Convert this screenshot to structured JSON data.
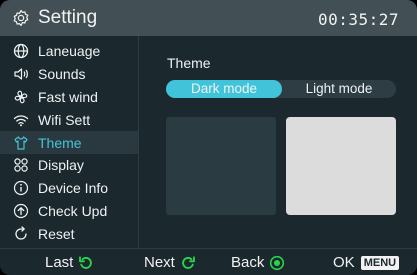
{
  "header": {
    "title": "Setting",
    "time": "00:35:27",
    "icon": "gear-icon"
  },
  "sidebar": {
    "items": [
      {
        "label": "Laneuage",
        "icon": "globe-icon",
        "active": false
      },
      {
        "label": "Sounds",
        "icon": "speaker-icon",
        "active": false
      },
      {
        "label": "Fast wind",
        "icon": "fan-icon",
        "active": false
      },
      {
        "label": "Wifi Sett",
        "icon": "wifi-icon",
        "active": false
      },
      {
        "label": "Theme",
        "icon": "shirt-icon",
        "active": true
      },
      {
        "label": "Display",
        "icon": "display-grid-icon",
        "active": false
      },
      {
        "label": "Device Info",
        "icon": "info-icon",
        "active": false
      },
      {
        "label": "Check Upd",
        "icon": "upload-icon",
        "active": false
      },
      {
        "label": "Reset",
        "icon": "reset-icon",
        "active": false
      }
    ]
  },
  "main": {
    "section_label": "Theme",
    "options": {
      "dark": "Dark mode",
      "light": "Light mode",
      "selected": "Dark mode"
    }
  },
  "footer": {
    "last": "Last",
    "next": "Next",
    "back": "Back",
    "ok": "OK",
    "menu_key": "MENU"
  },
  "colors": {
    "accent": "#41c4da",
    "green": "#2bd34a",
    "background": "#1b282e",
    "header": "#425055"
  }
}
